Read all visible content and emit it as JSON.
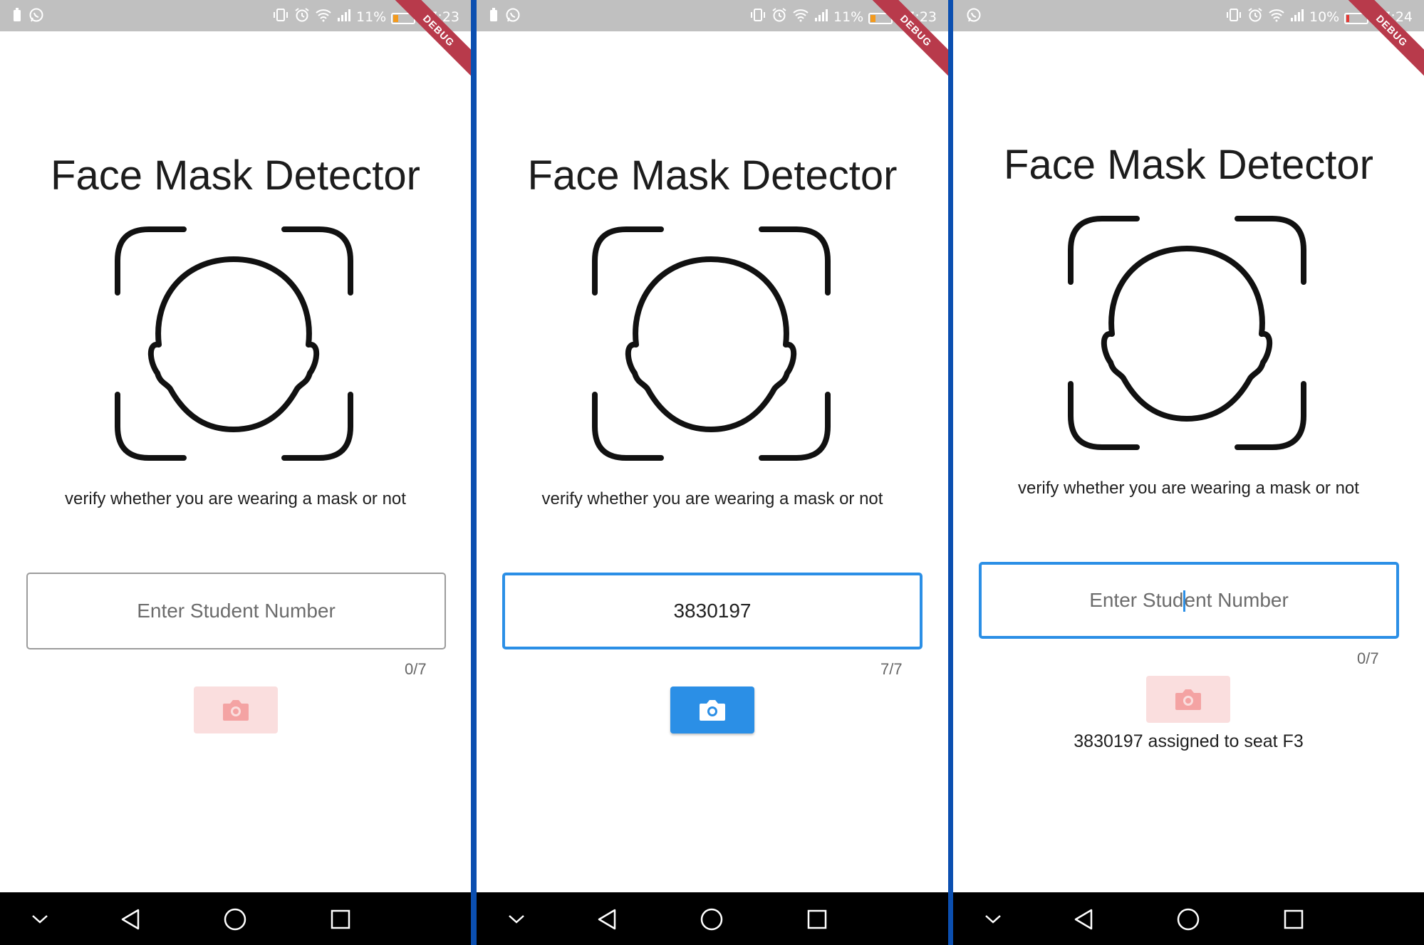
{
  "screens": [
    {
      "status_time": "17:23",
      "battery_percent": "11%",
      "battery_color": "#f39a1e",
      "left_icons": [
        "battery-saver-icon",
        "whatsapp-icon"
      ],
      "debug_banner": "DEBUG",
      "title": "Face Mask Detector",
      "subtitle": "verify whether you are wearing a mask or not",
      "input": {
        "placeholder": "Enter Student Number",
        "value": "",
        "focused": false
      },
      "counter": "0/7",
      "camera_button": {
        "enabled": false,
        "icon": "camera-icon"
      },
      "result": ""
    },
    {
      "status_time": "17:23",
      "battery_percent": "11%",
      "battery_color": "#f39a1e",
      "left_icons": [
        "battery-saver-icon",
        "whatsapp-icon"
      ],
      "debug_banner": "DEBUG",
      "title": "Face Mask Detector",
      "subtitle": "verify whether you are wearing a mask or not",
      "input": {
        "placeholder": "Enter Student Number",
        "value": "3830197",
        "focused": true
      },
      "counter": "7/7",
      "camera_button": {
        "enabled": true,
        "icon": "camera-icon"
      },
      "result": ""
    },
    {
      "status_time": "17:24",
      "battery_percent": "10%",
      "battery_color": "#e53935",
      "left_icons": [
        "whatsapp-icon"
      ],
      "debug_banner": "DEBUG",
      "title": "Face Mask Detector",
      "subtitle": "verify whether you are wearing a mask or not",
      "input": {
        "placeholder_before_cursor": "Enter Stud",
        "placeholder_after_cursor": "ent Number",
        "value": "",
        "focused": true
      },
      "counter": "0/7",
      "camera_button": {
        "enabled": false,
        "icon": "camera-icon"
      },
      "result": "3830197 assigned to seat F3"
    }
  ],
  "colors": {
    "accent": "#2b8fe6",
    "divider": "#0b4fb0",
    "camera_disabled_bg": "#fadede",
    "camera_disabled_icon": "#f4a3a3",
    "debug_ribbon": "#b83a4b"
  },
  "navbar_icons": [
    "chevron-down-icon",
    "back-icon",
    "home-icon",
    "recents-icon"
  ]
}
